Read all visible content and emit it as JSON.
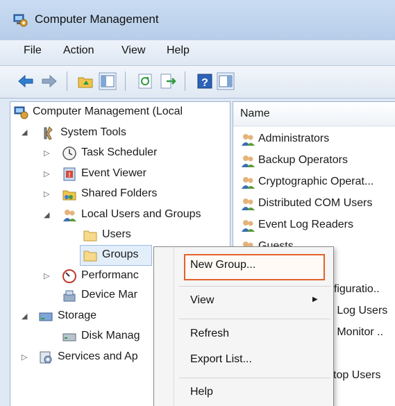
{
  "window": {
    "title": "Computer Management"
  },
  "menu": {
    "file": "File",
    "action": "Action",
    "view": "View",
    "help": "Help"
  },
  "tree": {
    "root": "Computer Management (Local",
    "system_tools": "System Tools",
    "task_scheduler": "Task Scheduler",
    "event_viewer": "Event Viewer",
    "shared_folders": "Shared Folders",
    "local_users_groups": "Local Users and Groups",
    "users": "Users",
    "groups": "Groups",
    "performance": "Performanc",
    "device_manager": "Device Mar",
    "storage": "Storage",
    "disk_management": "Disk Manag",
    "services_apps": "Services and Ap"
  },
  "list": {
    "header": "Name",
    "rows": [
      "Administrators",
      "Backup Operators",
      "Cryptographic Operat...",
      "Distributed COM Users",
      "Event Log Readers",
      "Guests"
    ],
    "partial": [
      "nfiguratio..",
      "e Log Users",
      "e Monitor ..",
      "ktop Users"
    ]
  },
  "context_menu": {
    "new_group": "New Group...",
    "view": "View",
    "refresh": "Refresh",
    "export_list": "Export List...",
    "help": "Help"
  }
}
